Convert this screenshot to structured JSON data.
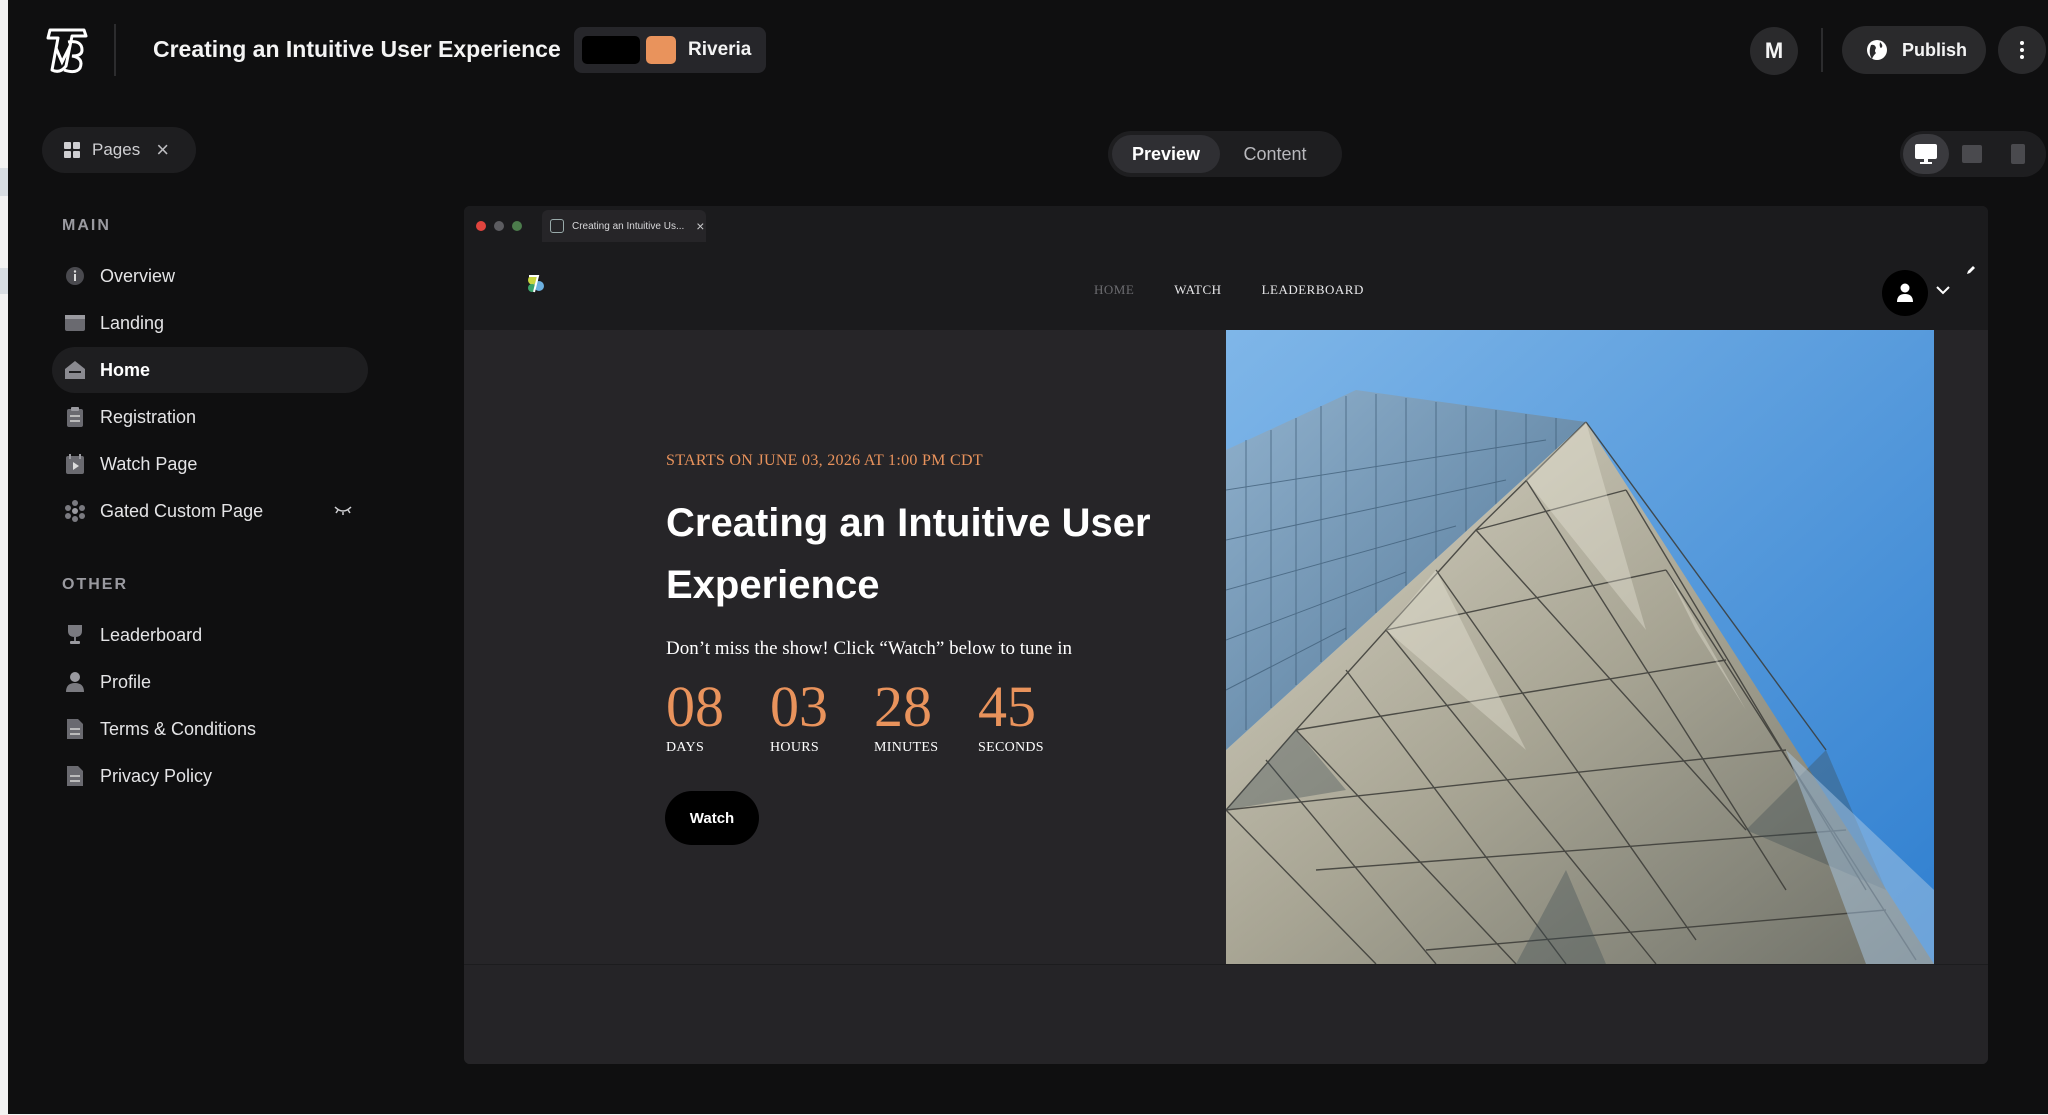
{
  "header": {
    "event_title": "Creating an Intuitive User Experience",
    "theme_name": "Riveria",
    "theme_colors": [
      "#000000",
      "#e9935c"
    ],
    "user_initial": "M",
    "publish_label": "Publish"
  },
  "toolbar": {
    "pages_label": "Pages",
    "view_tabs": [
      "Preview",
      "Content"
    ],
    "active_view": "Preview",
    "devices": [
      "desktop",
      "tablet",
      "mobile"
    ],
    "active_device": "desktop"
  },
  "sidebar": {
    "main_label": "MAIN",
    "main_items": [
      {
        "label": "Overview",
        "icon": "info-icon"
      },
      {
        "label": "Landing",
        "icon": "browser-window-icon"
      },
      {
        "label": "Home",
        "icon": "home-icon",
        "active": true
      },
      {
        "label": "Registration",
        "icon": "clipboard-icon"
      },
      {
        "label": "Watch Page",
        "icon": "play-calendar-icon"
      },
      {
        "label": "Gated Custom Page",
        "icon": "grid-dots-icon",
        "hidden": true
      }
    ],
    "other_label": "OTHER",
    "other_items": [
      {
        "label": "Leaderboard",
        "icon": "trophy-icon"
      },
      {
        "label": "Profile",
        "icon": "person-icon"
      },
      {
        "label": "Terms & Conditions",
        "icon": "document-icon"
      },
      {
        "label": "Privacy Policy",
        "icon": "document-icon"
      }
    ]
  },
  "preview": {
    "tab_title": "Creating an Intuitive Us...",
    "nav_links": [
      "HOME",
      "WATCH",
      "LEADERBOARD"
    ],
    "current_link": "HOME",
    "starts_on": "STARTS ON  JUNE 03, 2026 AT 1:00 PM CDT",
    "title": "Creating an Intuitive User Experience",
    "subtitle": "Don’t miss the show! Click “Watch” below to tune in",
    "countdown": [
      {
        "value": "08",
        "unit": "DAYS"
      },
      {
        "value": "03",
        "unit": "HOURS"
      },
      {
        "value": "28",
        "unit": "MINUTES"
      },
      {
        "value": "45",
        "unit": "SECONDS"
      }
    ],
    "watch_label": "Watch",
    "accent_color": "#e9935c"
  }
}
